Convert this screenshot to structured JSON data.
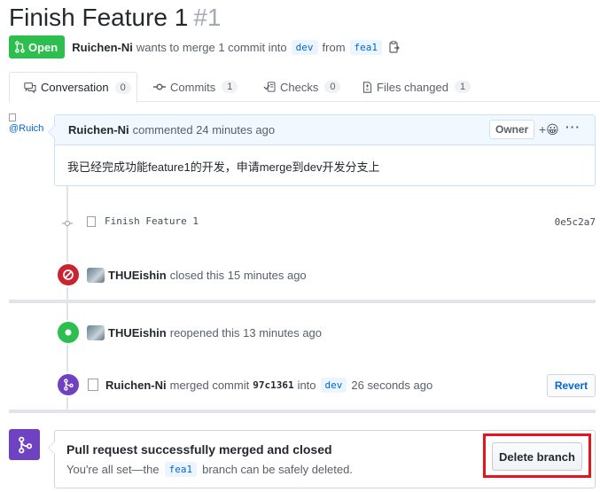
{
  "pr": {
    "title": "Finish Feature 1",
    "number": "#1",
    "state": "Open",
    "author": "Ruichen-Ni",
    "meta_text": "wants to merge 1 commit into",
    "base_branch": "dev",
    "from_text": "from",
    "head_branch": "fea1"
  },
  "tabs": [
    {
      "label": "Conversation",
      "count": "0"
    },
    {
      "label": "Commits",
      "count": "1"
    },
    {
      "label": "Checks",
      "count": "0"
    },
    {
      "label": "Files changed",
      "count": "1"
    }
  ],
  "comment": {
    "avatar_alt": "@Ruichen-",
    "author": "Ruichen-Ni",
    "action": "commented 24 minutes ago",
    "badge": "Owner",
    "reaction": "+😀",
    "more": "···",
    "body": "我已经完成功能feature1的开发，申请merge到dev开发分支上"
  },
  "commit": {
    "message": "Finish Feature 1",
    "sha": "0e5c2a7"
  },
  "events": {
    "closed": {
      "actor": "THUEishin",
      "text": "closed this 15 minutes ago"
    },
    "reopened": {
      "actor": "THUEishin",
      "text": "reopened this 13 minutes ago"
    },
    "merged": {
      "actor": "Ruichen-Ni",
      "text_before": "merged commit",
      "sha": "97c1361",
      "into": "into",
      "branch": "dev",
      "time": "26 seconds ago",
      "revert_label": "Revert"
    }
  },
  "merge_status": {
    "title": "Pull request successfully merged and closed",
    "sub_before": "You're all set—the",
    "branch": "fea1",
    "sub_after": "branch can be safely deleted.",
    "delete_label": "Delete branch"
  },
  "colors": {
    "open_green": "#2cbe4e",
    "closed_red": "#cb2431",
    "merged_purple": "#6f42c1",
    "link_blue": "#0366d6",
    "highlight_red": "#e8141c"
  }
}
